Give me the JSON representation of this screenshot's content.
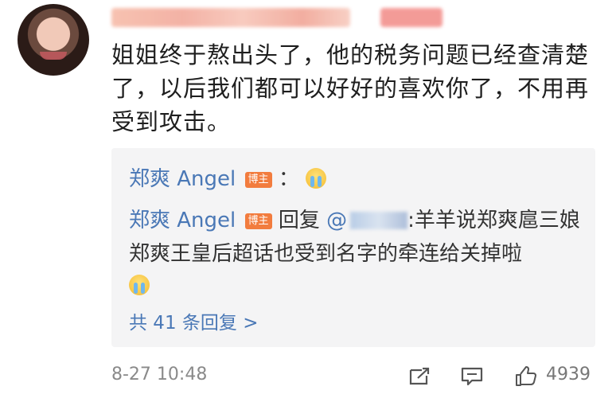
{
  "comment": {
    "text_lines": [
      "姐姐终于熬出头了，他的税务问题已经查清楚",
      "了，以后我们都可以好好的喜欢你了，不用再",
      "受到攻击。"
    ]
  },
  "replies": [
    {
      "name": "郑爽 Angel",
      "tag": "博主",
      "colon": "：",
      "emoji": "crying-emoji"
    },
    {
      "name": "郑爽 Angel",
      "tag": "博主",
      "action": "回复",
      "at": "@",
      "text_line1": ":羊羊说郑爽扈三娘",
      "text_line2": "郑爽王皇后超话也受到名字的牵连给关掉啦",
      "emoji": "crying-emoji"
    }
  ],
  "more_replies": "共 41 条回复 >",
  "footer": {
    "time": "8-27 10:48",
    "likes": "4939"
  },
  "icons": [
    "forward-icon",
    "comment-icon",
    "like-icon"
  ],
  "colors": {
    "link_blue": "#4a78b6",
    "tag_orange": "#f27c3e",
    "reply_bg": "#f4f4f5"
  }
}
